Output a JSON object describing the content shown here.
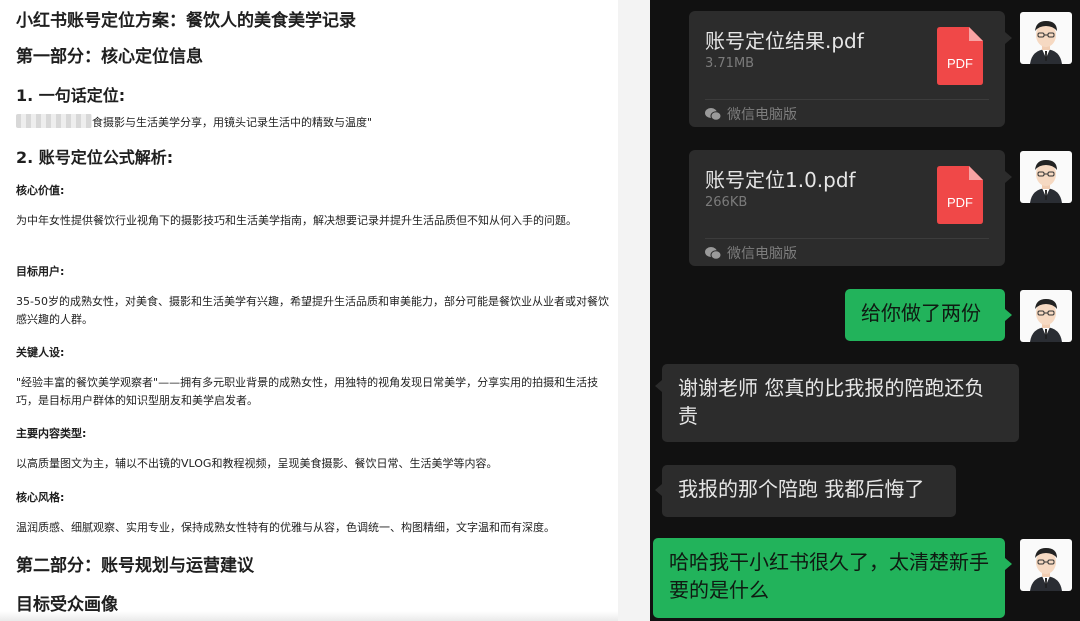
{
  "document": {
    "title": "小红书账号定位方案：餐饮人的美食美学记录",
    "part1_heading": "第一部分：核心定位信息",
    "sec1_heading": "1. 一句话定位:",
    "sec1_text": "食摄影与生活美学分享，用镜头记录生活中的精致与温度\"",
    "sec2_heading": "2. 账号定位公式解析:",
    "core_value_label": "核心价值:",
    "core_value_text": "为中年女性提供餐饮行业视角下的摄影技巧和生活美学指南，解决想要记录并提升生活品质但不知从何入手的问题。",
    "target_user_label": "目标用户:",
    "target_user_text": "35-50岁的成熟女性，对美食、摄影和生活美学有兴趣，希望提升生活品质和审美能力，部分可能是餐饮业从业者或对餐饮感兴趣的人群。",
    "persona_label": "关键人设:",
    "persona_text": "\"经验丰富的餐饮美学观察者\"——拥有多元职业背景的成熟女性，用独特的视角发现日常美学，分享实用的拍摄和生活技巧，是目标用户群体的知识型朋友和美学启发者。",
    "content_type_label": "主要内容类型:",
    "content_type_text": "以高质量图文为主，辅以不出镜的VLOG和教程视频，呈现美食摄影、餐饮日常、生活美学等内容。",
    "style_label": "核心风格:",
    "style_text": "温润质感、细腻观察、实用专业，保持成熟女性特有的优雅与从容，色调统一、构图精细，文字温和而有深度。",
    "part2_heading": "第二部分：账号规划与运营建议",
    "audience_heading": "目标受众画像"
  },
  "chat": {
    "files": [
      {
        "name": "账号定位结果.pdf",
        "size": "3.71MB",
        "icon_label": "PDF",
        "source": "微信电脑版"
      },
      {
        "name": "账号定位1.0.pdf",
        "size": "266KB",
        "icon_label": "PDF",
        "source": "微信电脑版"
      }
    ],
    "messages": [
      {
        "text": "给你做了两份"
      },
      {
        "text": "谢谢老师 您真的比我报的陪跑还负责"
      },
      {
        "text": "我报的那个陪跑 我都后悔了"
      },
      {
        "text": "哈哈我干小红书很久了，太清楚新手要的是什么"
      }
    ]
  },
  "colors": {
    "chat_bg": "#111111",
    "bubble_out": "#22b35b",
    "bubble_in": "#2c2c2c",
    "pdf_red": "#f04848",
    "wechat_icon": "#9a9a9a"
  }
}
